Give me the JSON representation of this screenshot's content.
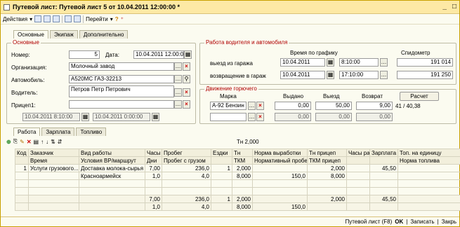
{
  "window": {
    "title": "Путевой лист: Путевой лист 5 от 10.04.2011 12:00:00 *",
    "minimize": "_",
    "maximize": "□"
  },
  "toolbar": {
    "actions": "Действия",
    "goto": "Перейти"
  },
  "tabs": [
    "Основные",
    "Экипаж",
    "Дополнительно"
  ],
  "basic": {
    "title": "Основные",
    "number_label": "Номер:",
    "number": "5",
    "date_label": "Дата:",
    "date": "10.04.2011 12:00:00",
    "org_label": "Организация:",
    "org": "Молочный завод",
    "car_label": "Автомобиль:",
    "car": "А520МС ГАЗ-32213",
    "driver_label": "Водитель:",
    "driver": "Петров Петр Петрович",
    "trailer_label": "Прицеп1:",
    "trailer": "",
    "date_from": "10.04.2011  8:10:00",
    "date_to": "10.04.2011  0:00:00"
  },
  "work": {
    "title": "Работа водителя и автомобиля",
    "schedule_label": "Время по графику",
    "speedo_label": "Спидометр",
    "out_label": "выезд из гаража",
    "out_date": "10.04.2011",
    "out_time": "8:10:00",
    "out_speedo": "191 014",
    "back_label": "возвращение в гараж",
    "back_date": "10.04.2011",
    "back_time": "17:10:00",
    "back_speedo": "191 250"
  },
  "fuel": {
    "title": "Движение горючего",
    "brand_label": "Марка",
    "issued_label": "Выдано",
    "out_label": "Выезд",
    "return_label": "Возврат",
    "calc_label": "Расчет",
    "brand": "А-92 Бензин",
    "issued": "0,00",
    "out": "50,00",
    "return": "9,00",
    "ratio": "41 / 40,38",
    "issued2": "0,00",
    "out2": "0,00",
    "return2": "0,00"
  },
  "lower_tabs": [
    "Работа",
    "Зарплата",
    "Топливо"
  ],
  "tn_total": "Тн 2,000",
  "grid": {
    "headers1": [
      "Код",
      "Заказчик",
      "Вид работы",
      "Часы",
      "Пробег",
      "Ездки",
      "Тн",
      "Норма выработки",
      "Тн прицеп",
      "Часы работы",
      "Зарплата",
      "Топ. на единицу"
    ],
    "headers2": [
      "",
      "Время",
      "Условия ВР/маршрут",
      "Дни",
      "Пробег с грузом",
      "",
      "ТКМ",
      "Нормативный пробег",
      "ТКМ прицеп",
      "",
      "",
      "Норма топлива"
    ],
    "row1": [
      "1",
      "Услуги грузового...",
      "Доставка молока-сырья",
      "7,00",
      "236,0",
      "1",
      "2,000",
      "",
      "2,000",
      "",
      "45,50",
      ""
    ],
    "row2": [
      "",
      "",
      "Красноармейск",
      "1,0",
      "4,0",
      "",
      "8,000",
      "150,0",
      "8,000",
      "",
      "",
      ""
    ],
    "total1": [
      "",
      "",
      "",
      "7,00",
      "236,0",
      "1",
      "2,000",
      "",
      "2,000",
      "",
      "45,50",
      ""
    ],
    "total2": [
      "",
      "",
      "",
      "1,0",
      "4,0",
      "",
      "8,000",
      "150,0",
      "",
      "",
      "",
      ""
    ]
  },
  "status": {
    "sheet": "Путевой лист (F8)",
    "ok": "OK",
    "save": "Записать",
    "close": "Закрь"
  }
}
